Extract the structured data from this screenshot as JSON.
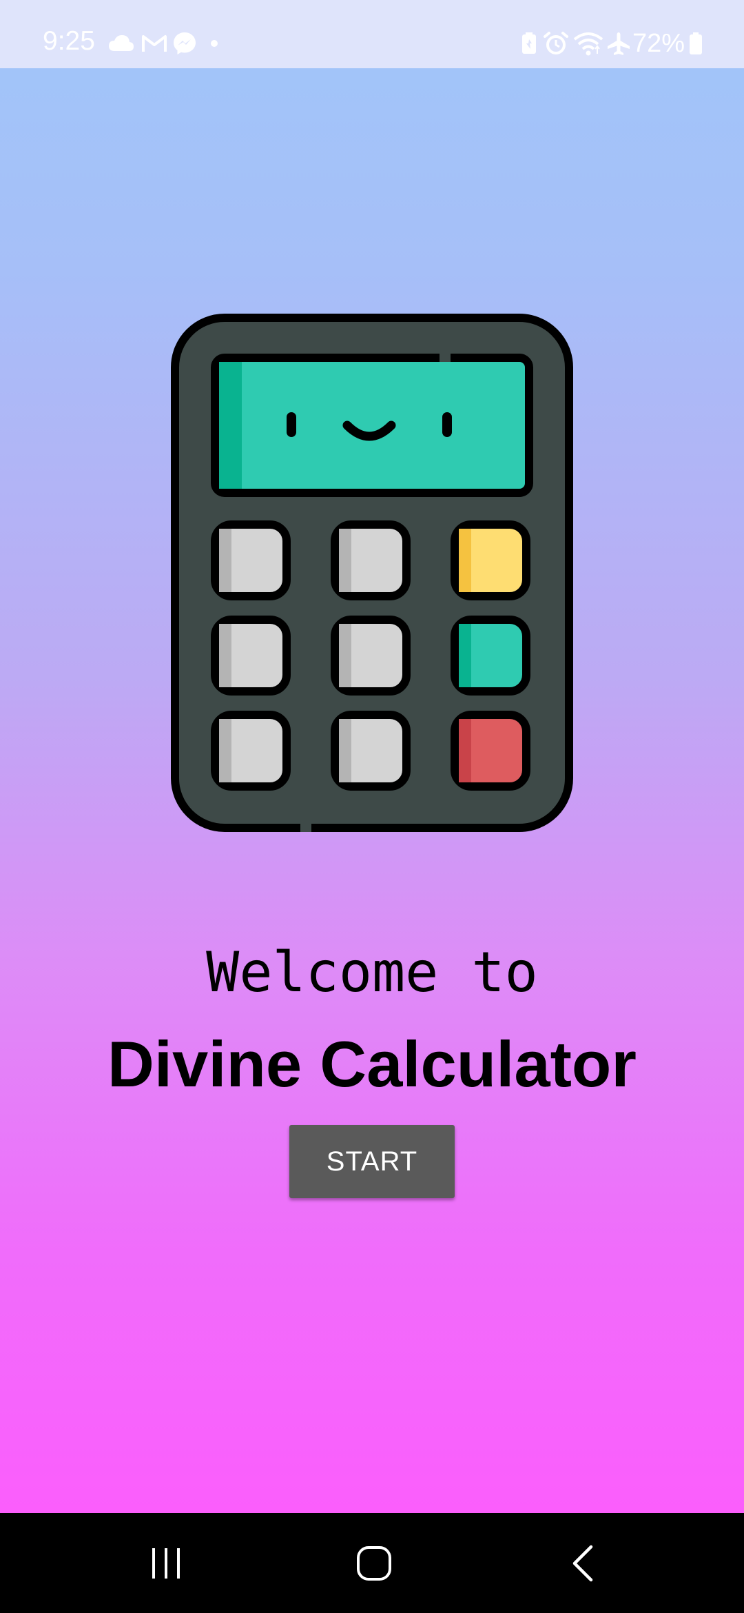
{
  "status_bar": {
    "time": "9:25",
    "battery_text": "72%",
    "left_icons": [
      "cloud-icon",
      "gmail-icon",
      "messenger-icon",
      "dot-icon"
    ],
    "right_icons": [
      "battery-saver-icon",
      "alarm-icon",
      "wifi-icon",
      "airplane-mode-icon",
      "battery-icon"
    ]
  },
  "welcome": {
    "line1": "Welcome to",
    "title": "Divine Calculator",
    "start_label": "START"
  },
  "illustration": {
    "icon": "calculator-icon",
    "colors": {
      "body": "#3e4a48",
      "screen": "#2fcbb1",
      "screen_shade": "#09b390",
      "key": "#d4d4d4",
      "key_yellow": "#fedd72",
      "key_teal": "#2fcbb1",
      "key_red": "#de5c5f",
      "outline": "#000000"
    }
  },
  "nav_bar": {
    "items": [
      "recents-icon",
      "home-icon",
      "back-icon"
    ]
  },
  "colors": {
    "gradient_top": "#a2c4f9",
    "gradient_bottom": "#fb5efc",
    "button_bg": "#5a5a5a",
    "status_bar_bg": "#dfe4fb"
  }
}
